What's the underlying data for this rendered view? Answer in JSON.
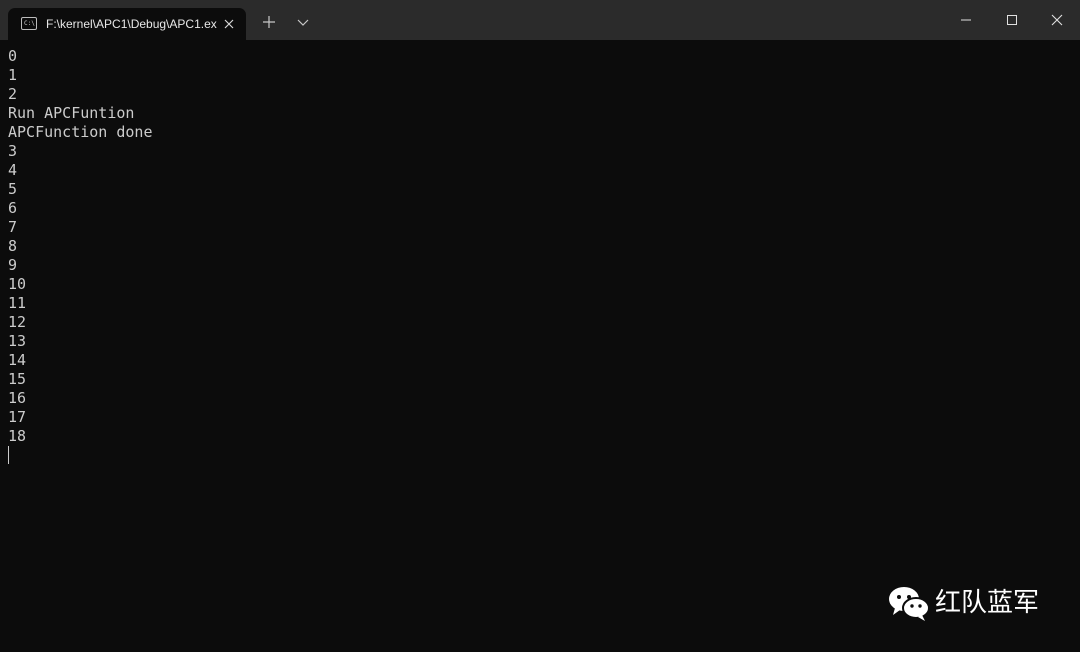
{
  "tab": {
    "title": "F:\\kernel\\APC1\\Debug\\APC1.ex",
    "icon": "console-icon",
    "icon_glyph": "C:\\"
  },
  "toolbar": {
    "new_tab_icon": "plus-icon",
    "dropdown_icon": "chevron-down-icon"
  },
  "window_controls": {
    "minimize_icon": "minimize-icon",
    "maximize_icon": "maximize-icon",
    "close_icon": "close-icon"
  },
  "console": {
    "lines": [
      "0",
      "1",
      "2",
      "Run APCFuntion",
      "APCFunction done",
      "3",
      "4",
      "5",
      "6",
      "7",
      "8",
      "9",
      "10",
      "11",
      "12",
      "13",
      "14",
      "15",
      "16",
      "17",
      "18"
    ]
  },
  "watermark": {
    "icon": "wechat-icon",
    "text": "红队蓝军"
  },
  "colors": {
    "background": "#0c0c0c",
    "titlebar": "#2b2b2b",
    "text": "#cccccc"
  }
}
